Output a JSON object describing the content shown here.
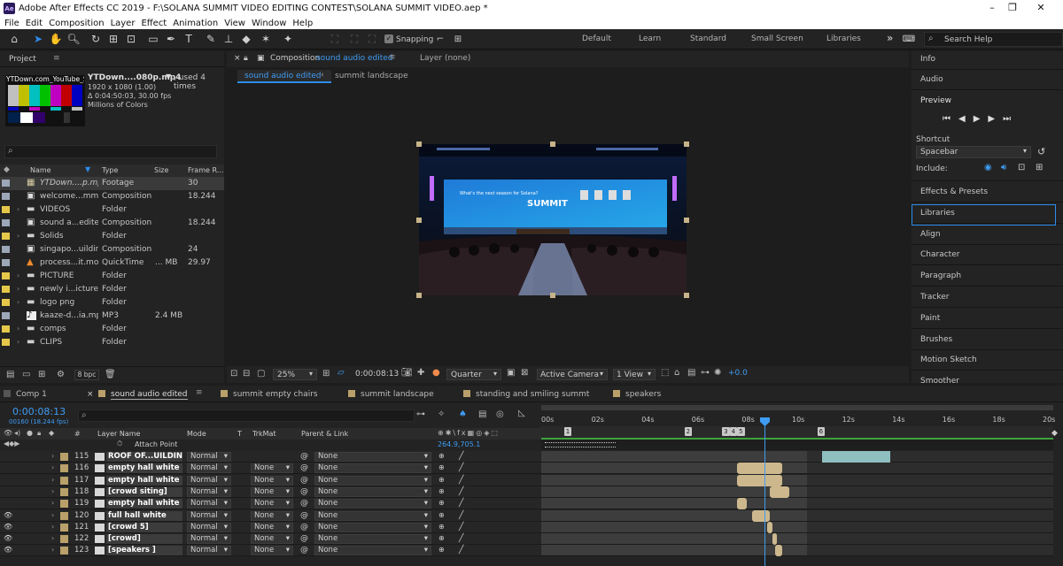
{
  "window": {
    "title": "Adobe After Effects CC 2019 - F:\\SOLANA SUMMIT VIDEO EDITING CONTEST\\SOLANA SUMMIT VIDEO.aep *",
    "logo": "Ae"
  },
  "menu": [
    "File",
    "Edit",
    "Composition",
    "Layer",
    "Effect",
    "Animation",
    "View",
    "Window",
    "Help"
  ],
  "toolbar": {
    "snapping_label": "Snapping",
    "workspaces": [
      "Default",
      "Learn",
      "Standard",
      "Small Screen",
      "Libraries"
    ],
    "more": "»",
    "search_placeholder": "Search Help"
  },
  "project": {
    "title": "Project",
    "thumb_label": "YTDown.com_YouTube_S",
    "footage_name": "YTDown....080p.mp4",
    "used_label": ", used 4 times",
    "dimensions": "1920 x 1080 (1.00)",
    "duration": "Δ 0:04:50:03, 30.00 fps",
    "colors": "Millions of Colors",
    "columns": {
      "name": "Name",
      "type": "Type",
      "size": "Size",
      "frame_rate": "Frame R..."
    },
    "items": [
      {
        "name": "YTDown....p.mp4",
        "type": "Footage",
        "size": "",
        "fps": "30",
        "label_color": "#9ca7b7",
        "kind": "footage",
        "selected": true
      },
      {
        "name": "welcome...mmit",
        "type": "Composition",
        "size": "",
        "fps": "18.244",
        "label_color": "#9ca7b7",
        "kind": "comp"
      },
      {
        "name": "VIDEOS",
        "type": "Folder",
        "size": "",
        "fps": "",
        "label_color": "#e5c84a",
        "kind": "folder"
      },
      {
        "name": "sound a...edited",
        "type": "Composition",
        "size": "",
        "fps": "18.244",
        "label_color": "#9ca7b7",
        "kind": "comp"
      },
      {
        "name": "Solids",
        "type": "Folder",
        "size": "",
        "fps": "",
        "label_color": "#e5c84a",
        "kind": "folder"
      },
      {
        "name": "singapo...uilding",
        "type": "Composition",
        "size": "",
        "fps": "24",
        "label_color": "#9ca7b7",
        "kind": "comp"
      },
      {
        "name": "process...it.mov",
        "type": "QuickTime",
        "size": "... MB",
        "fps": "29.97",
        "label_color": "#9ca7b7",
        "kind": "vlc"
      },
      {
        "name": "PICTURE",
        "type": "Folder",
        "size": "",
        "fps": "",
        "label_color": "#e5c84a",
        "kind": "folder"
      },
      {
        "name": "newly i...ictures",
        "type": "Folder",
        "size": "",
        "fps": "",
        "label_color": "#e5c84a",
        "kind": "folder"
      },
      {
        "name": "logo png",
        "type": "Folder",
        "size": "",
        "fps": "",
        "label_color": "#e5c84a",
        "kind": "folder"
      },
      {
        "name": "kaaze-d...ia.mp3",
        "type": "MP3",
        "size": "2.4 MB",
        "fps": "",
        "label_color": "#9ca7b7",
        "kind": "audio"
      },
      {
        "name": "comps",
        "type": "Folder",
        "size": "",
        "fps": "",
        "label_color": "#e5c84a",
        "kind": "folder"
      },
      {
        "name": "CLIPS",
        "type": "Folder",
        "size": "",
        "fps": "",
        "label_color": "#e5c84a",
        "kind": "folder"
      }
    ],
    "bpc": "8 bpc"
  },
  "composition": {
    "panel_prefix": "Composition",
    "panel_name": "sound audio edited",
    "layer_panel": "Layer  (none)",
    "breadcrumb": [
      "sound audio edited",
      "summit landscape"
    ],
    "zoom": "25%",
    "timecode": "0:00:08:13",
    "resolution": "Quarter",
    "camera": "Active Camera",
    "views": "1 View",
    "exposure": "+0.0",
    "screen_title": "What's the next season for Solana?",
    "screen_logo": "SUMMIT"
  },
  "right_panel": {
    "info": "Info",
    "audio": "Audio",
    "preview": "Preview",
    "shortcut_label": "Shortcut",
    "shortcut_value": "Spacebar",
    "include_label": "Include:",
    "items": [
      "Effects & Presets",
      "Libraries",
      "Align",
      "Character",
      "Paragraph",
      "Tracker",
      "Paint",
      "Brushes",
      "Motion Sketch",
      "Smoother"
    ]
  },
  "timeline": {
    "tabs": [
      "Comp 1",
      "sound audio edited",
      "summit empty chairs",
      "summit landscape",
      "standing and smiling summt",
      "speakers"
    ],
    "timecode": "0:00:08:13",
    "frame_info": "00160 (18.244 fps)",
    "columns": {
      "layer_name": "Layer Name",
      "mode": "Mode",
      "t": "T",
      "trkmat": "TrkMat",
      "parent": "Parent & Link"
    },
    "attach_point": "Attach Point",
    "attach_value": "264.9,705.1",
    "ruler": [
      "00s",
      "02s",
      "04s",
      "06s",
      "08s",
      "10s",
      "12s",
      "14s",
      "16s",
      "18s",
      "20s"
    ],
    "markers": [
      "1",
      "2",
      "3",
      "4",
      "5",
      "6"
    ],
    "layers": [
      {
        "num": "115",
        "name": "ROOF OF...UILDING",
        "mode": "Normal",
        "trkmat": "",
        "parent": "None",
        "visible": false,
        "bar_start": 11.0,
        "bar_end": 13.7
      },
      {
        "num": "116",
        "name": "empty hall white",
        "mode": "Normal",
        "trkmat": "None",
        "parent": "None",
        "visible": false,
        "bar_start": 7.6,
        "bar_end": 9.4
      },
      {
        "num": "117",
        "name": "empty hall white",
        "mode": "Normal",
        "trkmat": "None",
        "parent": "None",
        "visible": false,
        "bar_start": 7.6,
        "bar_end": 9.4
      },
      {
        "num": "118",
        "name": "[crowd siting]",
        "mode": "Normal",
        "trkmat": "None",
        "parent": "None",
        "visible": false,
        "bar_start": 8.9,
        "bar_end": 9.7
      },
      {
        "num": "119",
        "name": "empty hall white",
        "mode": "Normal",
        "trkmat": "None",
        "parent": "None",
        "visible": false,
        "bar_start": 7.6,
        "bar_end": 8.0
      },
      {
        "num": "120",
        "name": "full hall white",
        "mode": "Normal",
        "trkmat": "None",
        "parent": "None",
        "visible": true,
        "bar_start": 8.2,
        "bar_end": 8.9
      },
      {
        "num": "121",
        "name": "[crowd 5]",
        "mode": "Normal",
        "trkmat": "None",
        "parent": "None",
        "visible": true,
        "bar_start": 8.8,
        "bar_end": 9.0
      },
      {
        "num": "122",
        "name": "[crowd]",
        "mode": "Normal",
        "trkmat": "None",
        "parent": "None",
        "visible": true,
        "bar_start": 9.0,
        "bar_end": 9.2
      },
      {
        "num": "123",
        "name": "[speakers ]",
        "mode": "Normal",
        "trkmat": "None",
        "parent": "None",
        "visible": true,
        "bar_start": 9.1,
        "bar_end": 9.4
      }
    ]
  },
  "colors": {
    "accent": "#2d8ceb",
    "timecode": "#3f9cf4",
    "bar": "#cdb88e",
    "label_layer": "#b9a06a"
  }
}
